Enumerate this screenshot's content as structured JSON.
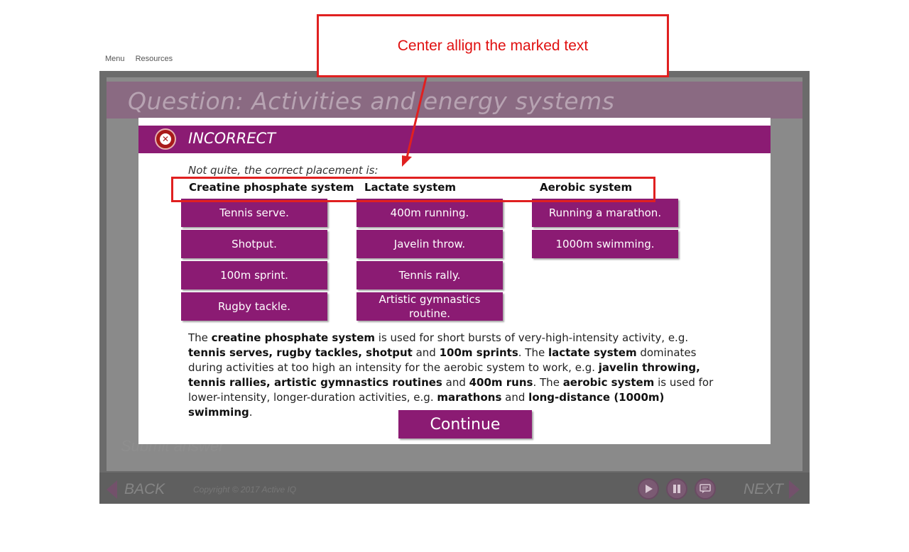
{
  "top_nav": {
    "menu": "Menu",
    "resources": "Resources"
  },
  "slide": {
    "title": "Question: Activities and energy systems",
    "submit_ghost": "Submit answer"
  },
  "player": {
    "back_label": "BACK",
    "next_label": "NEXT",
    "copyright": "Copyright © 2017 Active IQ",
    "controls": [
      "play-icon",
      "pause-icon",
      "captions-icon"
    ]
  },
  "modal": {
    "status": "INCORRECT",
    "intro": "Not quite, the correct placement is:",
    "columns": [
      {
        "heading": "Creatine phosphate system",
        "items": [
          "Tennis serve.",
          "Shotput.",
          "100m sprint.",
          "Rugby tackle."
        ]
      },
      {
        "heading": "Lactate system",
        "items": [
          "400m running.",
          "Javelin throw.",
          "Tennis rally.",
          "Artistic gymnastics routine."
        ]
      },
      {
        "heading": "Aerobic system",
        "items": [
          "Running a marathon.",
          "1000m swimming."
        ]
      }
    ],
    "feedback_parts": [
      {
        "t": "The ",
        "b": false
      },
      {
        "t": "creatine phosphate system",
        "b": true
      },
      {
        "t": " is used for short bursts of very-high-intensity activity, e.g. ",
        "b": false
      },
      {
        "t": "tennis serves, rugby tackles, shotput",
        "b": true
      },
      {
        "t": " and ",
        "b": false
      },
      {
        "t": "100m sprints",
        "b": true
      },
      {
        "t": ". The ",
        "b": false
      },
      {
        "t": "lactate system",
        "b": true
      },
      {
        "t": " dominates during activities at too high an intensity for the aerobic system to work, e.g. ",
        "b": false
      },
      {
        "t": "javelin throwing, tennis rallies, artistic gymnastics routines",
        "b": true
      },
      {
        "t": " and ",
        "b": false
      },
      {
        "t": "400m runs",
        "b": true
      },
      {
        "t": ". The ",
        "b": false
      },
      {
        "t": "aerobic system",
        "b": true
      },
      {
        "t": " is used for lower-intensity, longer-duration activities, e.g. ",
        "b": false
      },
      {
        "t": "marathons",
        "b": true
      },
      {
        "t": " and ",
        "b": false
      },
      {
        "t": "long-distance (1000m) swimming",
        "b": true
      },
      {
        "t": ".",
        "b": false
      }
    ],
    "continue_label": "Continue"
  },
  "annotation": {
    "callout_text": "Center allign the marked text",
    "color": "#e02020"
  },
  "colors": {
    "accent": "#8b1b73",
    "incorrect": "#a81a1a"
  }
}
